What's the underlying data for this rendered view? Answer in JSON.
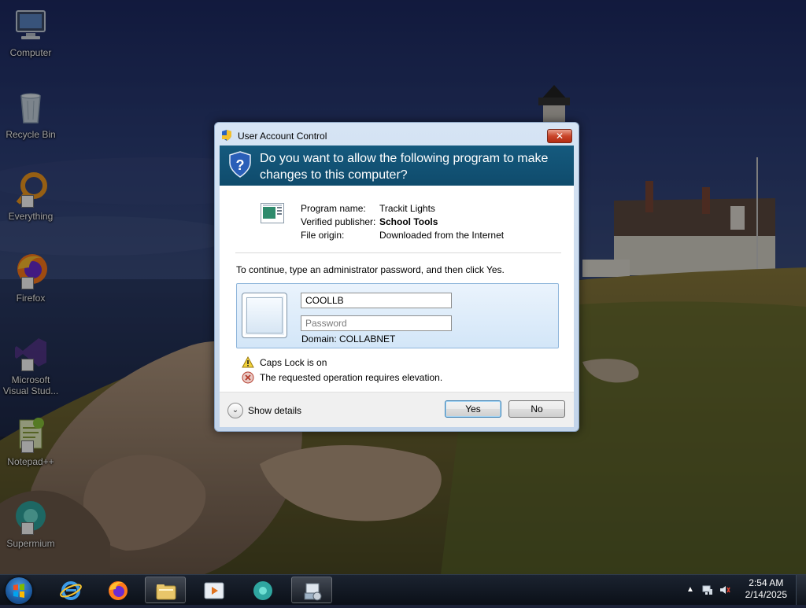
{
  "desktop": {
    "icons": [
      {
        "label": "Computer",
        "icon": "computer-icon"
      },
      {
        "label": "Recycle Bin",
        "icon": "recycle-bin-icon"
      },
      {
        "label": "Everything",
        "icon": "everything-icon"
      },
      {
        "label": "Firefox",
        "icon": "firefox-icon"
      },
      {
        "label": "Microsoft Visual Stud...",
        "icon": "visual-studio-icon"
      },
      {
        "label": "Notepad++",
        "icon": "notepadpp-icon"
      },
      {
        "label": "Supermium",
        "icon": "supermium-icon"
      }
    ]
  },
  "uac": {
    "window_title": "User Account Control",
    "close_glyph": "✕",
    "question": "Do you want to allow the following program to make changes to this computer?",
    "program": {
      "name_label": "Program name:",
      "name": "Trackit Lights",
      "publisher_label": "Verified publisher:",
      "publisher": "School Tools",
      "origin_label": "File origin:",
      "origin": "Downloaded from the Internet"
    },
    "instruction": "To continue, type an administrator password, and then click Yes.",
    "username_value": "COOLLB",
    "password_placeholder": "Password",
    "domain": "Domain: COLLABNET",
    "warning": "Caps Lock is on",
    "error": "The requested operation requires elevation.",
    "show_details": "Show details",
    "yes": "Yes",
    "no": "No"
  },
  "taskbar": {
    "apps": [
      "internet-explorer-icon",
      "firefox-icon",
      "file-explorer-icon",
      "media-player-icon",
      "supermium-icon",
      "installer-icon"
    ],
    "clock_time": "2:54 AM",
    "clock_date": "2/14/2025"
  },
  "colors": {
    "banner": "#155a7e",
    "window_frame": "#c2d4ea",
    "close_button": "#c9452a"
  }
}
